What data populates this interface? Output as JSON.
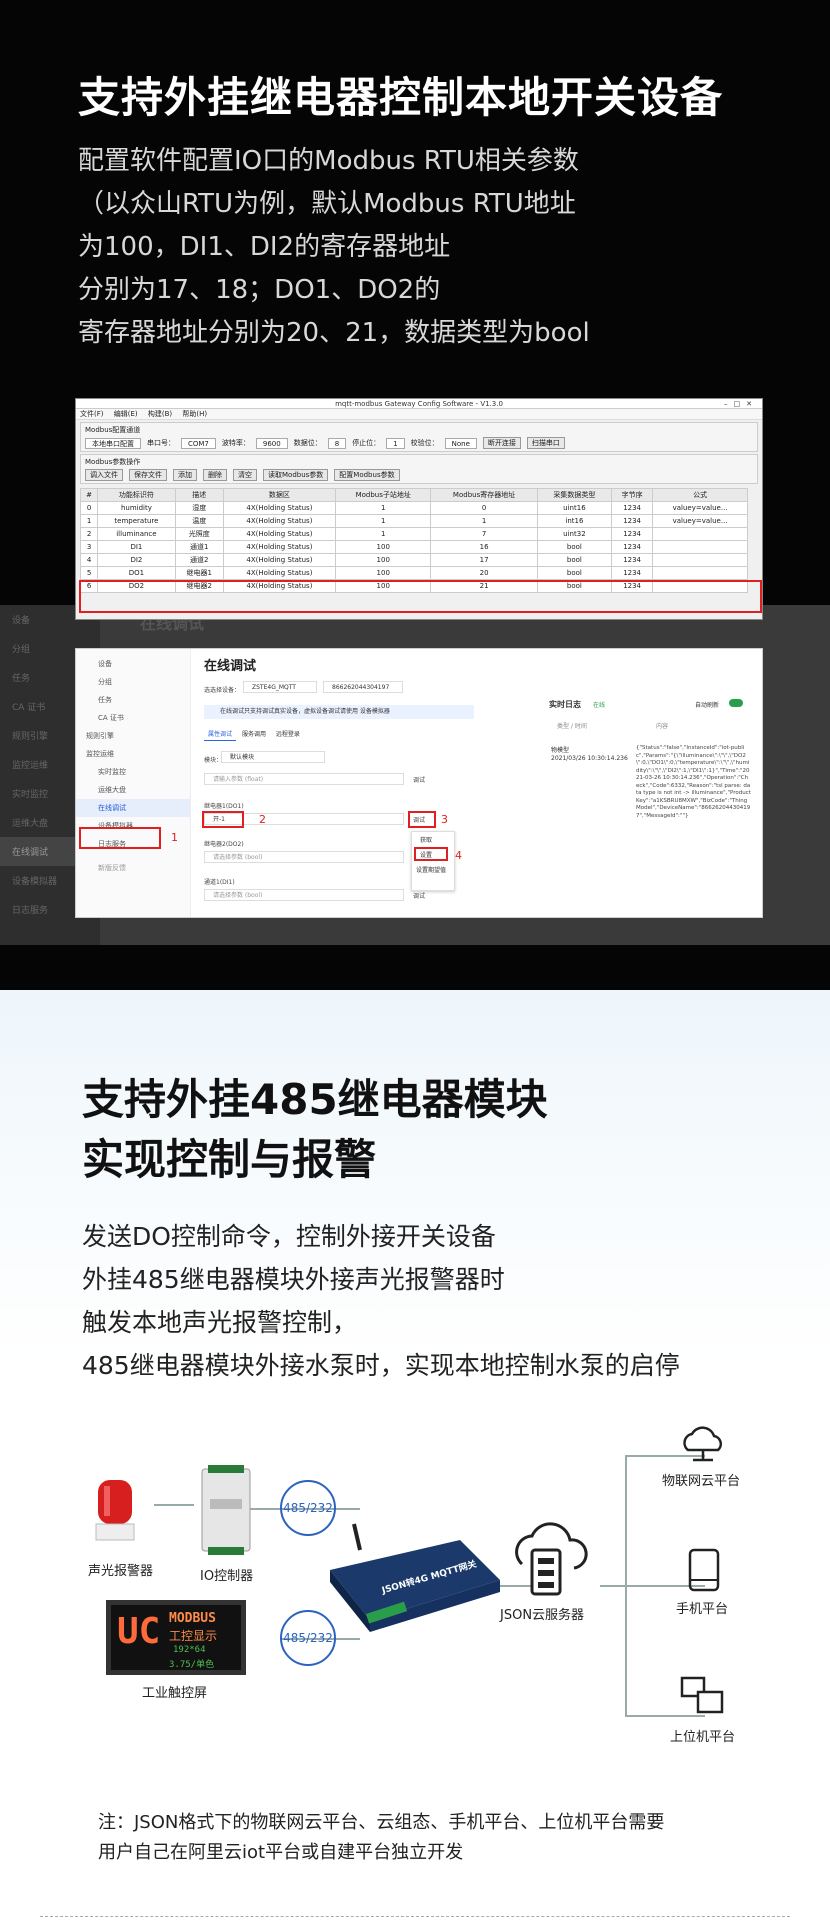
{
  "section1": {
    "title": "支持外挂继电器控制本地开关设备",
    "lines": [
      "配置软件配置IO口的Modbus RTU相关参数",
      "（以众山RTU为例，默认Modbus RTU地址",
      "为100，DI1、DI2的寄存器地址",
      "分别为17、18；DO1、DO2的",
      "寄存器地址分别为20、21，数据类型为bool"
    ]
  },
  "config_window": {
    "title": "mqtt-modbus Gateway Config Software - V1.3.0",
    "menu": [
      "文件(F)",
      "编辑(E)",
      "构建(B)",
      "帮助(H)"
    ],
    "channel_group": "Modbus配置通道",
    "channel_fields": {
      "mode": "本地串口配置",
      "port_label": "串口号：",
      "port": "COM7",
      "baud_label": "波特率：",
      "baud": "9600",
      "databits_label": "数据位：",
      "databits": "8",
      "stopbits_label": "停止位：",
      "stopbits": "1",
      "parity_label": "校验位：",
      "parity": "None",
      "open_btn": "断开连接",
      "scan_btn": "扫描串口"
    },
    "params_group": "Modbus参数操作",
    "toolbar": [
      "调入文件",
      "保存文件",
      "添加",
      "删除",
      "清空",
      "读取Modbus参数",
      "配置Modbus参数"
    ],
    "headers": [
      "#",
      "功能标识符",
      "描述",
      "数据区",
      "Modbus子站地址",
      "Modbus寄存器地址",
      "采集数据类型",
      "字节序",
      "公式"
    ],
    "rows": [
      [
        "0",
        "humidity",
        "湿度",
        "4X(Holding Status)",
        "1",
        "0",
        "uint16",
        "1234",
        "valuey=value..."
      ],
      [
        "1",
        "temperature",
        "温度",
        "4X(Holding Status)",
        "1",
        "1",
        "int16",
        "1234",
        "valuey=value..."
      ],
      [
        "2",
        "illuminance",
        "光照度",
        "4X(Holding Status)",
        "1",
        "7",
        "uint32",
        "1234",
        ""
      ],
      [
        "3",
        "DI1",
        "通道1",
        "4X(Holding Status)",
        "100",
        "16",
        "bool",
        "1234",
        ""
      ],
      [
        "4",
        "DI2",
        "通道2",
        "4X(Holding Status)",
        "100",
        "17",
        "bool",
        "1234",
        ""
      ],
      [
        "5",
        "DO1",
        "继电器1",
        "4X(Holding Status)",
        "100",
        "20",
        "bool",
        "1234",
        ""
      ],
      [
        "6",
        "DO2",
        "继电器2",
        "4X(Holding Status)",
        "100",
        "21",
        "bool",
        "1234",
        ""
      ]
    ]
  },
  "background_panel": {
    "menu": [
      "设备",
      "分组",
      "任务",
      "CA 证书",
      "规则引擎",
      "监控运维",
      "实时监控",
      "运维大盘",
      "在线调试",
      "设备模拟器",
      "日志服务"
    ],
    "title": "在线调试"
  },
  "console": {
    "sidebar": [
      "设备",
      "分组",
      "任务",
      "CA 证书",
      "规则引擎",
      "监控运维",
      "实时监控",
      "运维大盘",
      "在线调试",
      "设备模拟器",
      "日志服务",
      "新版反馈"
    ],
    "title": "在线调试",
    "device_label": "选选择设备：",
    "device_select": "ZSTE4G_MQTT",
    "device_id": "866262044304197",
    "notice": "在线调试只支持调试真实设备，虚拟设备调试请使用 设备模拟器",
    "tabs": [
      "属性调试",
      "服务调用",
      "远程登录"
    ],
    "module_label": "模块：",
    "module_value": "默认模块",
    "field_placeholder": "请输入参数 (float)",
    "relay1_label": "继电器1(DO1)",
    "relay1_value": "开-1",
    "relay2_label": "继电器2(DO2)",
    "relay2_placeholder": "请选择参数 (bool)",
    "channel1_label": "通道1(DI1)",
    "channel1_placeholder": "请选择参数 (bool)",
    "debug_label": "调试",
    "menu": [
      "获取",
      "设置",
      "设置期望值"
    ],
    "markers": [
      "1",
      "2",
      "3",
      "4"
    ],
    "log_title": "实时日志",
    "log_status": "在线",
    "auto_refresh": "自动刷新",
    "log_cols": [
      "类型 / 时间",
      "内容"
    ],
    "log_type": "物模型",
    "log_time": "2021/03/26 10:30:14.236",
    "log_content": "{\"Status\":\"false\",\"InstanceId\":\"iot-public\",\"Params\":\"{\\\"illuminance\\\":\\\"\\\",\\\"DO2\\\":0,\\\"DO1\\\":0,\\\"temperature\\\":\\\"\\\",\\\"humidity\\\":\\\"\\\",\\\"DI2\\\":1,\\\"DI1\\\":1}\",\"Time\":\"2021-03-26 10:30:14.236\",\"Operation\":\"Check\",\"Code\":6332,\"Reason\":\"tsl parse: data type is not int -> illuminance\",\"ProductKey\":\"a1KSBRU8MXW\",\"BizCode\":\"ThingModel\",\"DeviceName\":\"866262044304197\",\"MessageId\":\"\"}"
  },
  "section2": {
    "title_lines": [
      "支持外挂485继电器模块",
      "实现控制与报警"
    ],
    "lines": [
      "发送DO控制命令，控制外接开关设备",
      "外挂485继电器模块外接声光报警器时",
      "触发本地声光报警控制，",
      "485继电器模块外接水泵时，实现本地控制水泵的启停"
    ]
  },
  "diagram": {
    "alarm": "声光报警器",
    "io": "IO控制器",
    "hmi": "工业触控屏",
    "bus1": "485/232",
    "bus2": "485/232",
    "gateway": "JSON转4G MQTT网关",
    "server": "JSON云服务器",
    "cloud": "物联网云平台",
    "phone": "手机平台",
    "pc": "上位机平台",
    "hmi_screen": {
      "uc": "UC",
      "modbus": "MODBUS",
      "cn": "工控显示",
      "v1": "192*64",
      "v2": "3.75/单色"
    }
  },
  "note": [
    "注：JSON格式下的物联网云平台、云组态、手机平台、上位机平台需要",
    "用户自己在阿里云iot平台或自建平台独立开发"
  ],
  "colors": {
    "accent_red": "#e02020",
    "link_blue": "#2a63e0"
  }
}
